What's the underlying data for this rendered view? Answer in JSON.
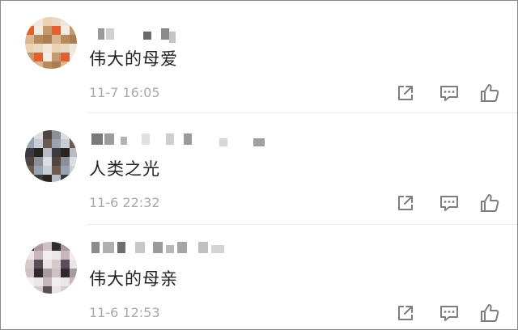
{
  "comments": [
    {
      "text": "伟大的母爱",
      "time": "11-7 16:05",
      "avatar_icon": "pixelated-avatar",
      "avatar_palette": [
        "#e8d8c4",
        "#d9b891",
        "#c49a6c",
        "#f0e6da",
        "#b58a5c",
        "#e06030",
        "#ecd2b0",
        "#a97f52",
        "#f4ece2"
      ],
      "icons": {
        "share": "share-icon",
        "reply": "comment-icon",
        "like": "thumbs-up-icon"
      }
    },
    {
      "text": "人类之光",
      "time": "11-6 22:32",
      "avatar_icon": "pixelated-avatar",
      "avatar_palette": [
        "#c9ced6",
        "#8a8f98",
        "#3b3b3f",
        "#6d5a4e",
        "#dadde2",
        "#2a2420",
        "#9aa4b0",
        "#4f4540",
        "#b7bcc4"
      ],
      "icons": {
        "share": "share-icon",
        "reply": "comment-icon",
        "like": "thumbs-up-icon"
      }
    },
    {
      "text": "伟大的母亲",
      "time": "11-6 12:53",
      "avatar_icon": "pixelated-avatar",
      "avatar_palette": [
        "#e9e4e6",
        "#c7b6bc",
        "#2e2a30",
        "#d8c9cd",
        "#f2eef0",
        "#a89aa0",
        "#5a4e56",
        "#ece6e8",
        "#cfc2c6"
      ],
      "icons": {
        "share": "share-icon",
        "reply": "comment-icon",
        "like": "thumbs-up-icon"
      }
    }
  ],
  "colors": {
    "text": "#222222",
    "meta": "#a8a8a8",
    "icon": "#7d7d7d",
    "divider": "#ececec",
    "border": "#8a8a8a"
  }
}
